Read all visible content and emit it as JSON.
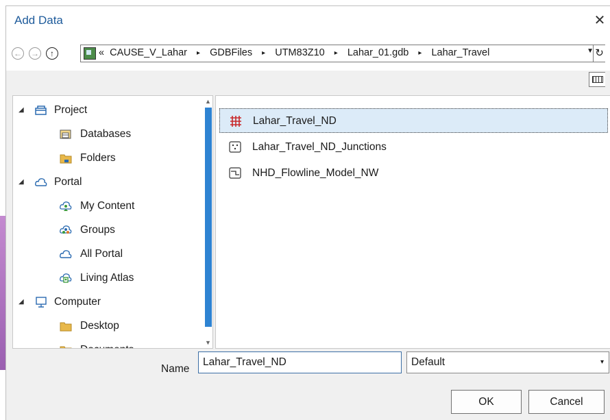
{
  "dialog": {
    "title": "Add Data",
    "close": "✕"
  },
  "nav": {
    "back": "←",
    "forward": "→",
    "up": "↑",
    "overflow": "«",
    "path": [
      "CAUSE_V_Lahar",
      "GDBFiles",
      "UTM83Z10",
      "Lahar_01.gdb",
      "Lahar_Travel"
    ],
    "separator": "▸",
    "dropdown": "▼",
    "refresh": "↻"
  },
  "tree": [
    {
      "label": "Project",
      "icon": "project-icon",
      "expanded": true
    },
    {
      "label": "Databases",
      "icon": "databases-icon"
    },
    {
      "label": "Folders",
      "icon": "folders-icon"
    },
    {
      "label": "Portal",
      "icon": "portal-icon",
      "expanded": true
    },
    {
      "label": "My Content",
      "icon": "my-content-icon"
    },
    {
      "label": "Groups",
      "icon": "groups-icon"
    },
    {
      "label": "All Portal",
      "icon": "all-portal-icon"
    },
    {
      "label": "Living Atlas",
      "icon": "living-atlas-icon"
    },
    {
      "label": "Computer",
      "icon": "computer-icon",
      "expanded": true
    },
    {
      "label": "Desktop",
      "icon": "desktop-icon"
    },
    {
      "label": "Documents",
      "icon": "documents-icon"
    }
  ],
  "tree_arrow": "◢",
  "files": [
    {
      "label": "Lahar_Travel_ND",
      "icon": "network-dataset-icon",
      "selected": true
    },
    {
      "label": "Lahar_Travel_ND_Junctions",
      "icon": "point-feature-class-icon"
    },
    {
      "label": "NHD_Flowline_Model_NW",
      "icon": "line-feature-class-icon"
    }
  ],
  "bottom": {
    "name_label": "Name",
    "name_value": "Lahar_Travel_ND",
    "filter_value": "Default",
    "filter_dd": "▾",
    "ok": "OK",
    "cancel": "Cancel"
  },
  "colors": {
    "title": "#1e5b9b",
    "selection": "#dcebf8",
    "scroll_thumb": "#2e83d2",
    "folder": "#e8b84a"
  }
}
